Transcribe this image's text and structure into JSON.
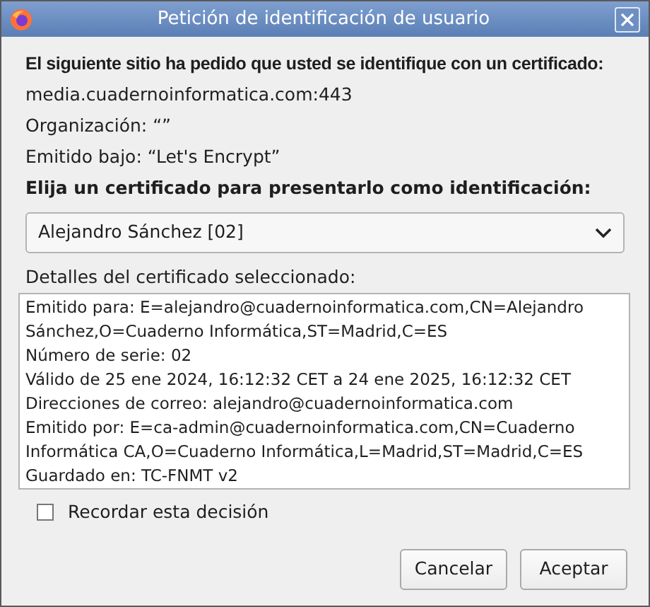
{
  "window": {
    "title": "Petición de identificación de usuario"
  },
  "heading": "El siguiente sitio ha pedido que usted se identifique con un certificado:",
  "site": "media.cuadernoinformatica.com:443",
  "organization": "Organización: “”",
  "issuer": "Emitido bajo: “Let's Encrypt”",
  "choose_label": "Elija un certificado para presentarlo como identificación:",
  "certificate_select": {
    "value": "Alejandro Sánchez [02]"
  },
  "details_label": "Detalles del certificado seleccionado:",
  "details": [
    "Emitido para: E=alejandro@cuadernoinformatica.com,CN=Alejandro Sánchez,O=Cuaderno Informática,ST=Madrid,C=ES",
    "Número de serie: 02",
    "Válido de 25 ene 2024, 16:12:32 CET a 24 ene 2025, 16:12:32 CET",
    "Direcciones de correo: alejandro@cuadernoinformatica.com",
    "Emitido por: E=ca-admin@cuadernoinformatica.com,CN=Cuaderno Informática CA,O=Cuaderno Informática,L=Madrid,ST=Madrid,C=ES",
    "Guardado en: TC-FNMT v2"
  ],
  "remember": {
    "label": "Recordar esta decisión",
    "checked": false
  },
  "buttons": [
    "Cancelar",
    "Aceptar"
  ]
}
